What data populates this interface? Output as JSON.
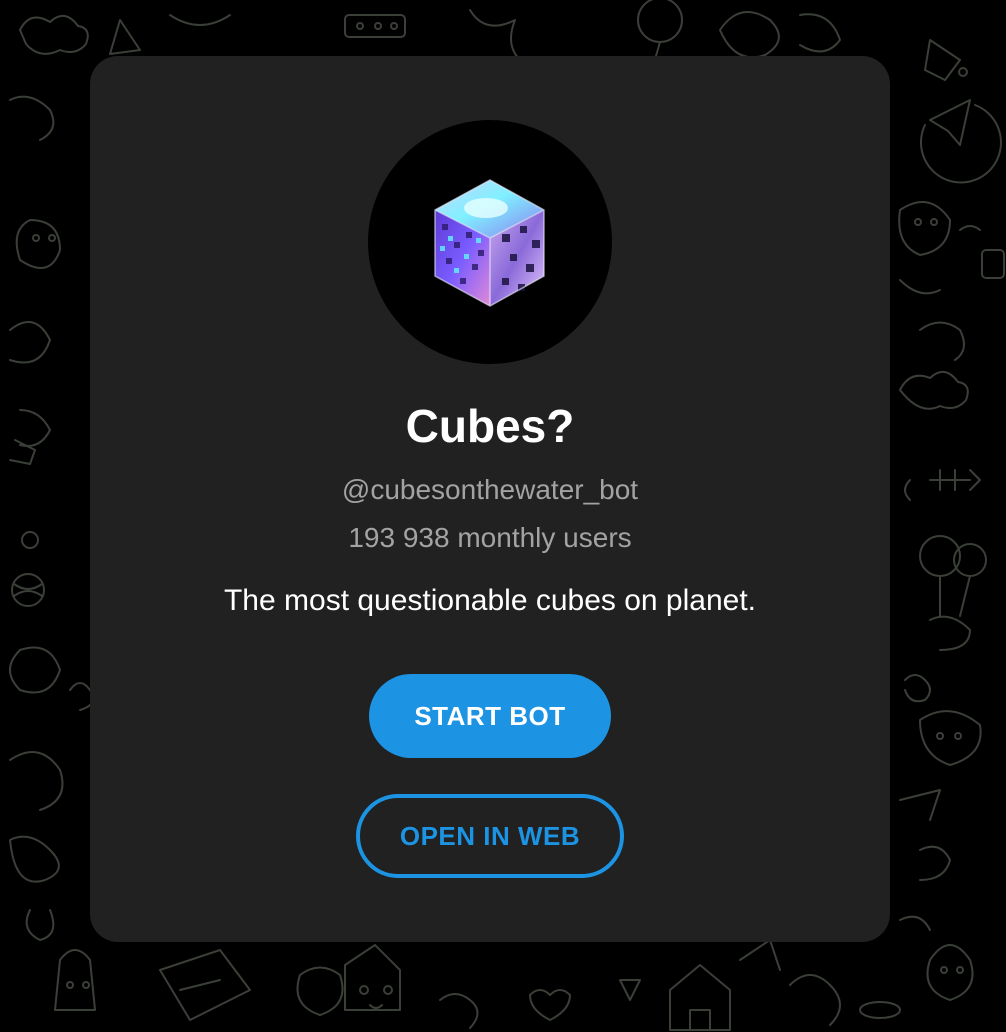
{
  "bot": {
    "name": "Cubes?",
    "username": "@cubesonthewater_bot",
    "monthly_users": "193 938 monthly users",
    "description": "The most questionable cubes on planet."
  },
  "actions": {
    "start_label": "START BOT",
    "web_label": "OPEN IN WEB"
  },
  "icons": {
    "avatar": "glowing-cube-icon",
    "background": "doodle-pattern"
  },
  "colors": {
    "accent": "#1c93e3",
    "card": "#212121",
    "page": "#000000",
    "secondary_text": "#a3a3a3"
  }
}
